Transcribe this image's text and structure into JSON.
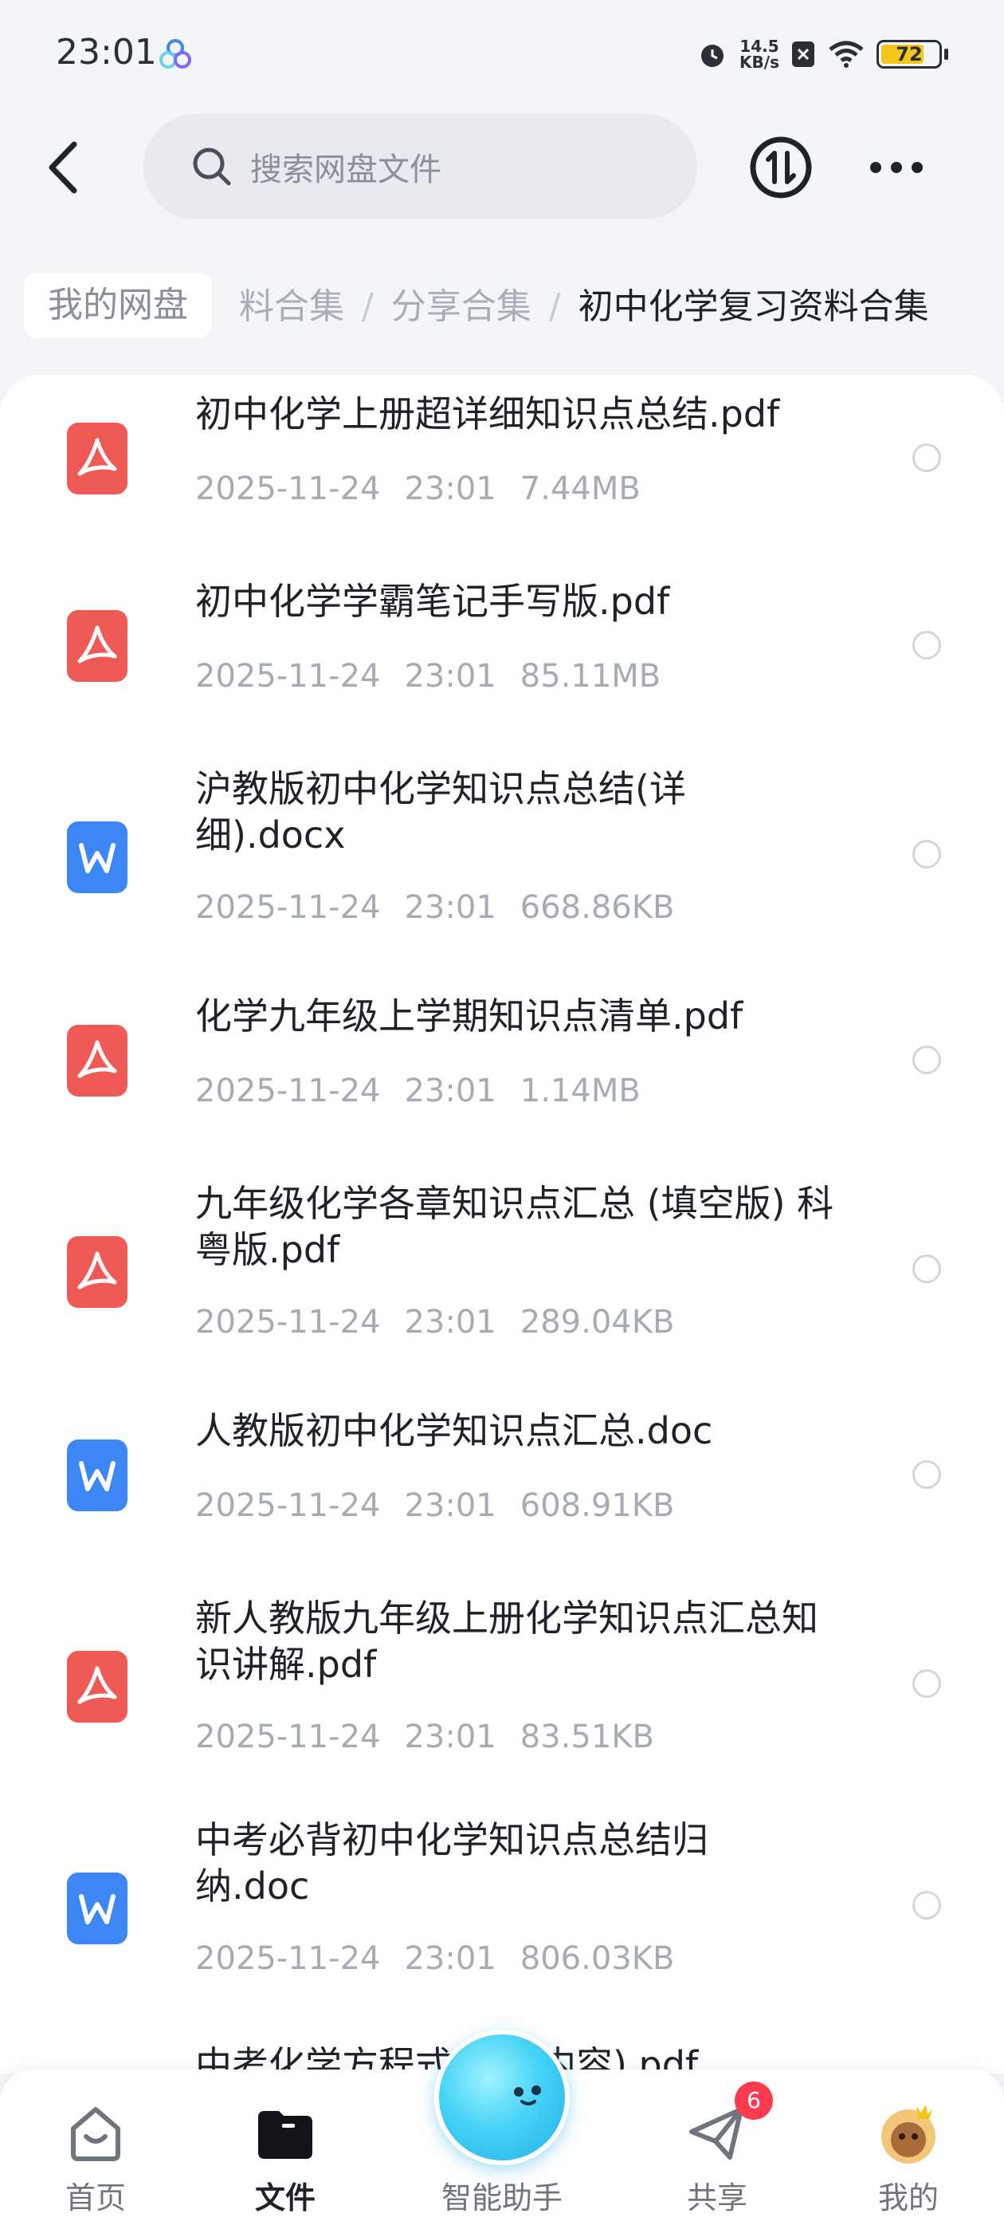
{
  "status_bar": {
    "time": "23:01",
    "net_speed_value": "14.5",
    "net_speed_unit": "KB/s",
    "battery": "72",
    "battery_color": "#f5c518"
  },
  "header": {
    "search_placeholder": "搜索网盘文件"
  },
  "breadcrumb": {
    "root": "我的网盘",
    "partial": "料合集",
    "middle": "分享合集",
    "current": "初中化学复习资料合集"
  },
  "files": [
    {
      "name": "初中化学上册超详细知识点总结.pdf",
      "date": "2025-11-24",
      "time": "23:01",
      "size": "7.44MB",
      "type": "pdf"
    },
    {
      "name": "初中化学学霸笔记手写版.pdf",
      "date": "2025-11-24",
      "time": "23:01",
      "size": "85.11MB",
      "type": "pdf"
    },
    {
      "name": "沪教版初中化学知识点总结(详细).docx",
      "date": "2025-11-24",
      "time": "23:01",
      "size": "668.86KB",
      "type": "word"
    },
    {
      "name": "化学九年级上学期知识点清单.pdf",
      "date": "2025-11-24",
      "time": "23:01",
      "size": "1.14MB",
      "type": "pdf"
    },
    {
      "name": "九年级化学各章知识点汇总 (填空版) 科粤版.pdf",
      "date": "2025-11-24",
      "time": "23:01",
      "size": "289.04KB",
      "type": "pdf"
    },
    {
      "name": "人教版初中化学知识点汇总.doc",
      "date": "2025-11-24",
      "time": "23:01",
      "size": "608.91KB",
      "type": "word"
    },
    {
      "name": "新人教版九年级上册化学知识点汇总知识讲解.pdf",
      "date": "2025-11-24",
      "time": "23:01",
      "size": "83.51KB",
      "type": "pdf"
    },
    {
      "name": "中考必背初中化学知识点总结归纳.doc",
      "date": "2025-11-24",
      "time": "23:01",
      "size": "806.03KB",
      "type": "word"
    },
    {
      "name": "中考化学方程式(必考内容).pdf",
      "date": "",
      "time": "",
      "size": "",
      "type": "pdf"
    }
  ],
  "nav": {
    "home": "首页",
    "files": "文件",
    "assistant": "智能助手",
    "share": "共享",
    "me": "我的",
    "share_badge": "6"
  },
  "colors": {
    "pdf": "#ef5a57",
    "word": "#3c86f5",
    "accent": "#1fb2e8"
  }
}
